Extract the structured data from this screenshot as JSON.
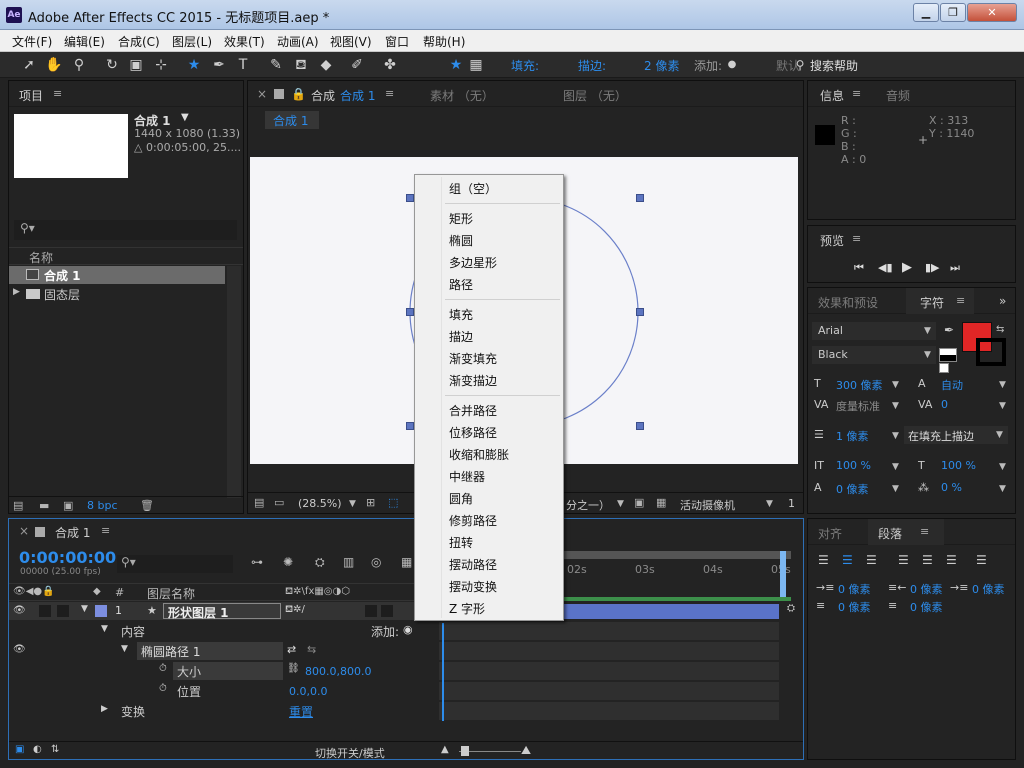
{
  "window": {
    "app_icon": "Ae",
    "title": "Adobe After Effects CC 2015 - 无标题项目.aep *",
    "minimize": "▁",
    "restore": "❐",
    "close": "✕"
  },
  "menu": [
    "文件(F)",
    "编辑(E)",
    "合成(C)",
    "图层(L)",
    "效果(T)",
    "动画(A)",
    "视图(V)",
    "窗口",
    "帮助(H)"
  ],
  "toolbar": {
    "fill_label": "填充:",
    "fill_color": "#ff0000",
    "stroke_label": "描边:",
    "stroke_width": "2 像素",
    "add_label": "添加:",
    "default_text": "默认",
    "search_help": "搜索帮助",
    "icons": [
      "selection-tool-icon",
      "hand-tool-icon",
      "zoom-tool-icon",
      "rotate-tool-icon",
      "camera-tool-icon",
      "pan-behind-tool-icon",
      "shape-tool-icon",
      "pen-tool-icon",
      "type-tool-icon",
      "brush-tool-icon",
      "clone-stamp-tool-icon",
      "eraser-tool-icon",
      "roto-brush-tool-icon",
      "puppet-pin-tool-icon"
    ]
  },
  "project": {
    "tab": "项目",
    "comp_name": "合成 1",
    "comp_size": "1440 x 1080 (1.33)",
    "comp_duration": "△ 0:00:05:00, 25....",
    "search_placeholder": "",
    "col_name": "名称",
    "items": [
      {
        "name": "合成 1",
        "type": "composition"
      },
      {
        "name": "固态层",
        "type": "folder"
      }
    ],
    "bpc": "8 bpc"
  },
  "viewer": {
    "tabs": [
      "合成",
      "合成 1",
      "素材 （无）",
      "图层 （无）"
    ],
    "breadcrumb": "合成 1",
    "zoom": "(28.5%)",
    "resolution": "分之一）",
    "camera": "活动摄像机",
    "views": "1"
  },
  "context_menu": {
    "groups": [
      [
        "组（空）"
      ],
      [
        "矩形",
        "椭圆",
        "多边星形",
        "路径"
      ],
      [
        "填充",
        "描边",
        "渐变填充",
        "渐变描边"
      ],
      [
        "合并路径",
        "位移路径",
        "收缩和膨胀",
        "中继器",
        "圆角",
        "修剪路径",
        "扭转",
        "摆动路径",
        "摆动变换",
        "Z 字形"
      ]
    ]
  },
  "info": {
    "tabs": [
      "信息",
      "音频"
    ],
    "r": "R :",
    "g": "G :",
    "b": "B :",
    "a": "A : 0",
    "x": "X : 313",
    "y": "Y : 1140"
  },
  "preview": {
    "tab": "预览"
  },
  "character": {
    "tabs": [
      "效果和预设",
      "字符"
    ],
    "font": "Arial",
    "style": "Black",
    "font_size": "300 像素",
    "leading": "自动",
    "kerning": "度量标准",
    "tracking": "0",
    "stroke_width": "1 像素",
    "stroke_mode": "在填充上描边",
    "vscale": "100 %",
    "hscale": "100 %",
    "baseline": "0 像素",
    "tsume": "0 %",
    "fill_color": "#e02626"
  },
  "paragraph": {
    "tabs": [
      "对齐",
      "段落"
    ],
    "indent_left": "0 像素",
    "indent_right": "0 像素",
    "indent_first": "0 像素",
    "space_before": "0 像素",
    "space_after": "0 像素"
  },
  "timeline": {
    "tab": "合成 1",
    "timecode": "0:00:00:00",
    "frames": "00000 (25.00 fps)",
    "col_num": "#",
    "col_layer_name": "图层名称",
    "ruler": [
      "02s",
      "03s",
      "04s",
      "05s"
    ],
    "layer": {
      "index": "1",
      "name": "形状图层 1"
    },
    "contents": "内容",
    "add": "添加:",
    "ellipse_path": "椭圆路径 1",
    "size_label": "大小",
    "size_value": "800.0,800.0",
    "position_label": "位置",
    "position_value": "0.0,0.0",
    "transform": "变换",
    "reset": "重置",
    "toggle_modes": "切换开关/模式"
  }
}
